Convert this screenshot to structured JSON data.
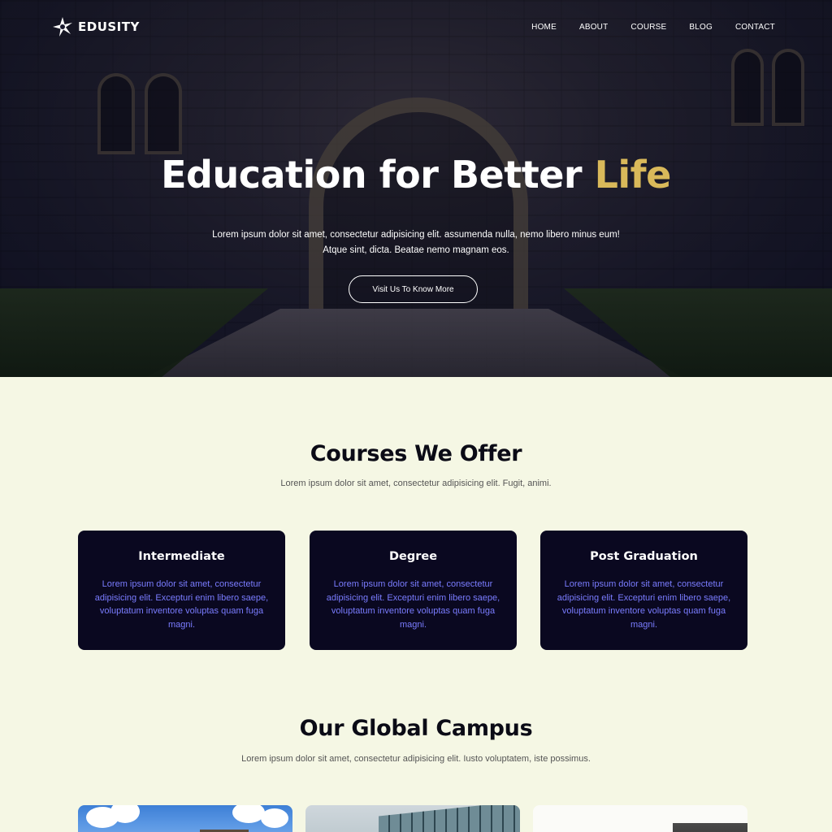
{
  "brand": {
    "name": "EDUSITY"
  },
  "nav": {
    "items": [
      "HOME",
      "ABOUT",
      "COURSE",
      "BLOG",
      "CONTACT"
    ]
  },
  "hero": {
    "title_main": "Education for Better",
    "title_accent": "Life",
    "description_line1": "Lorem ipsum dolor sit amet, consectetur adipisicing elit. assumenda nulla, nemo libero minus eum!",
    "description_line2": "Atque sint, dicta. Beatae nemo magnam eos.",
    "cta_label": "Visit Us To Know More",
    "accent_color": "#d9b95a"
  },
  "courses": {
    "title": "Courses We Offer",
    "subtitle": "Lorem ipsum dolor sit amet, consectetur adipisicing elit. Fugit, animi.",
    "cards": [
      {
        "title": "Intermediate",
        "text": "Lorem ipsum dolor sit amet, consectetur adipisicing elit. Excepturi enim libero saepe, voluptatum inventore voluptas quam fuga magni."
      },
      {
        "title": "Degree",
        "text": "Lorem ipsum dolor sit amet, consectetur adipisicing elit. Excepturi enim libero saepe, voluptatum inventore voluptas quam fuga magni."
      },
      {
        "title": "Post Graduation",
        "text": "Lorem ipsum dolor sit amet, consectetur adipisicing elit. Excepturi enim libero saepe, voluptatum inventore voluptas quam fuga magni."
      }
    ],
    "card_bg": "#0a0820",
    "card_text_color": "#7a7cff"
  },
  "campus": {
    "title": "Our Global Campus",
    "subtitle": "Lorem ipsum dolor sit amet, consectetur adipisicing elit. Iusto voluptatem, iste possimus."
  },
  "page_bg": "#f5f7e4"
}
